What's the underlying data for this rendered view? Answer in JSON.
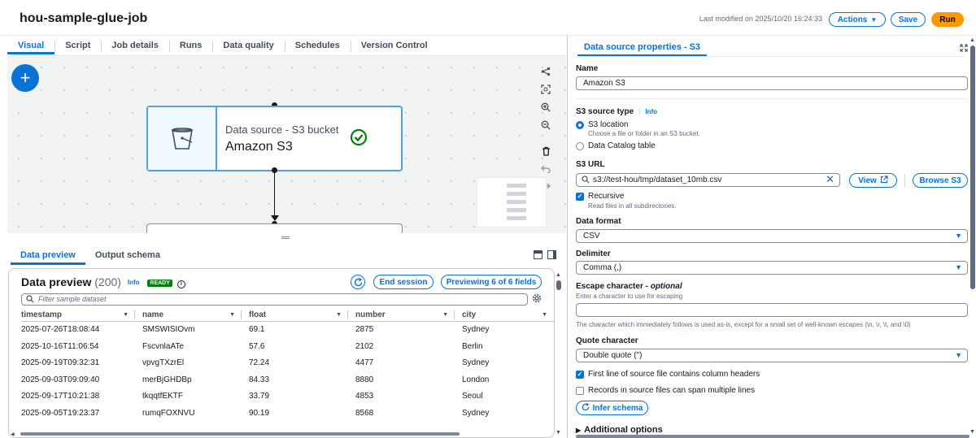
{
  "header": {
    "job_title": "hou-sample-glue-job",
    "last_modified": "Last modified on 2025/10/20 16:24:33",
    "actions_label": "Actions",
    "save_label": "Save",
    "run_label": "Run"
  },
  "tabs": [
    "Visual",
    "Script",
    "Job details",
    "Runs",
    "Data quality",
    "Schedules",
    "Version Control"
  ],
  "canvas": {
    "node": {
      "type": "Data source - S3 bucket",
      "name": "Amazon S3"
    }
  },
  "bottom_tabs": [
    "Data preview",
    "Output schema"
  ],
  "preview": {
    "title": "Data preview",
    "count": "(200)",
    "info": "Info",
    "status": "READY",
    "end_session": "End session",
    "previewing": "Previewing 6 of 6 fields",
    "filter_placeholder": "Filter sample dataset",
    "columns": [
      "timestamp",
      "name",
      "float",
      "number",
      "city"
    ],
    "rows": [
      [
        "2025-07-26T18:08:44",
        "SMSWISIOvm",
        "69.1",
        "2875",
        "Sydney"
      ],
      [
        "2025-10-16T11:06:54",
        "FscvnlaATe",
        "57.6",
        "2102",
        "Berlin"
      ],
      [
        "2025-09-19T09:32:31",
        "vpvgTXzrEl",
        "72.24",
        "4477",
        "Sydney"
      ],
      [
        "2025-09-03T09:09:40",
        "merBjGHDBp",
        "84.33",
        "8880",
        "London"
      ],
      [
        "2025-09-17T10:21:38",
        "tkqqtfEKTF",
        "33.79",
        "4853",
        "Seoul"
      ],
      [
        "2025-09-05T19:23:37",
        "rumqFOXNVU",
        "90.19",
        "8568",
        "Sydney"
      ]
    ]
  },
  "panel": {
    "tab": "Data source properties - S3",
    "name_label": "Name",
    "name_value": "Amazon S3",
    "source_type_label": "S3 source type",
    "info": "Info",
    "opt_s3_location": "S3 location",
    "opt_s3_location_hint": "Choose a file or folder in an S3 bucket.",
    "opt_catalog": "Data Catalog table",
    "s3_url_label": "S3 URL",
    "s3_url_value": "s3://test-hou/tmp/dataset_10mb.csv",
    "view_label": "View",
    "browse_label": "Browse S3",
    "recursive_label": "Recursive",
    "recursive_hint": "Read files in all subdirectories.",
    "format_label": "Data format",
    "format_value": "CSV",
    "delimiter_label": "Delimiter",
    "delimiter_value": "Comma (,)",
    "escape_label": "Escape character - ",
    "escape_optional": "optional",
    "escape_placeholder": "Enter a character to use for escaping",
    "escape_hint": "The character which immediately follows is used as-is, except for a small set of well-known escapes (\\n, \\r, \\t, and \\0)",
    "quote_label": "Quote character",
    "quote_value": "Double quote (\")",
    "first_line_label": "First line of source file contains column headers",
    "multiline_label": "Records in source files can span multiple lines",
    "infer_label": "Infer schema",
    "additional_label": "Additional options"
  },
  "colors": {
    "accent": "#0972d3",
    "run": "#ff9900",
    "ready": "#037f0c",
    "success": "#037f0c"
  }
}
